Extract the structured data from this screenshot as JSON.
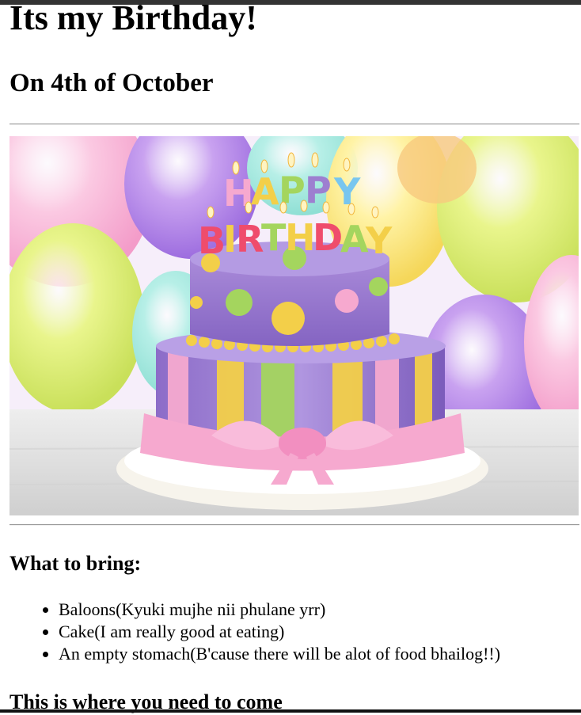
{
  "page": {
    "title": "Its my Birthday!",
    "subtitle": "On 4th of October",
    "image": {
      "icon": "birthday-cake-photo",
      "cake_text": "HAPPY BIRTHDAY"
    },
    "bring_heading": "What to bring:",
    "bring_items": [
      "Baloons(Kyuki mujhe nii phulane yrr)",
      "Cake(I am really good at eating)",
      "An empty stomach(B'cause there will be alot of food bhailog!!)"
    ],
    "location_heading": "This is where you need to come"
  },
  "colors": {
    "cake_purple": "#9d7fd0",
    "ribbon_pink": "#f6a9cf",
    "accent_yellow": "#f3cf49",
    "accent_green": "#a4d55e"
  }
}
